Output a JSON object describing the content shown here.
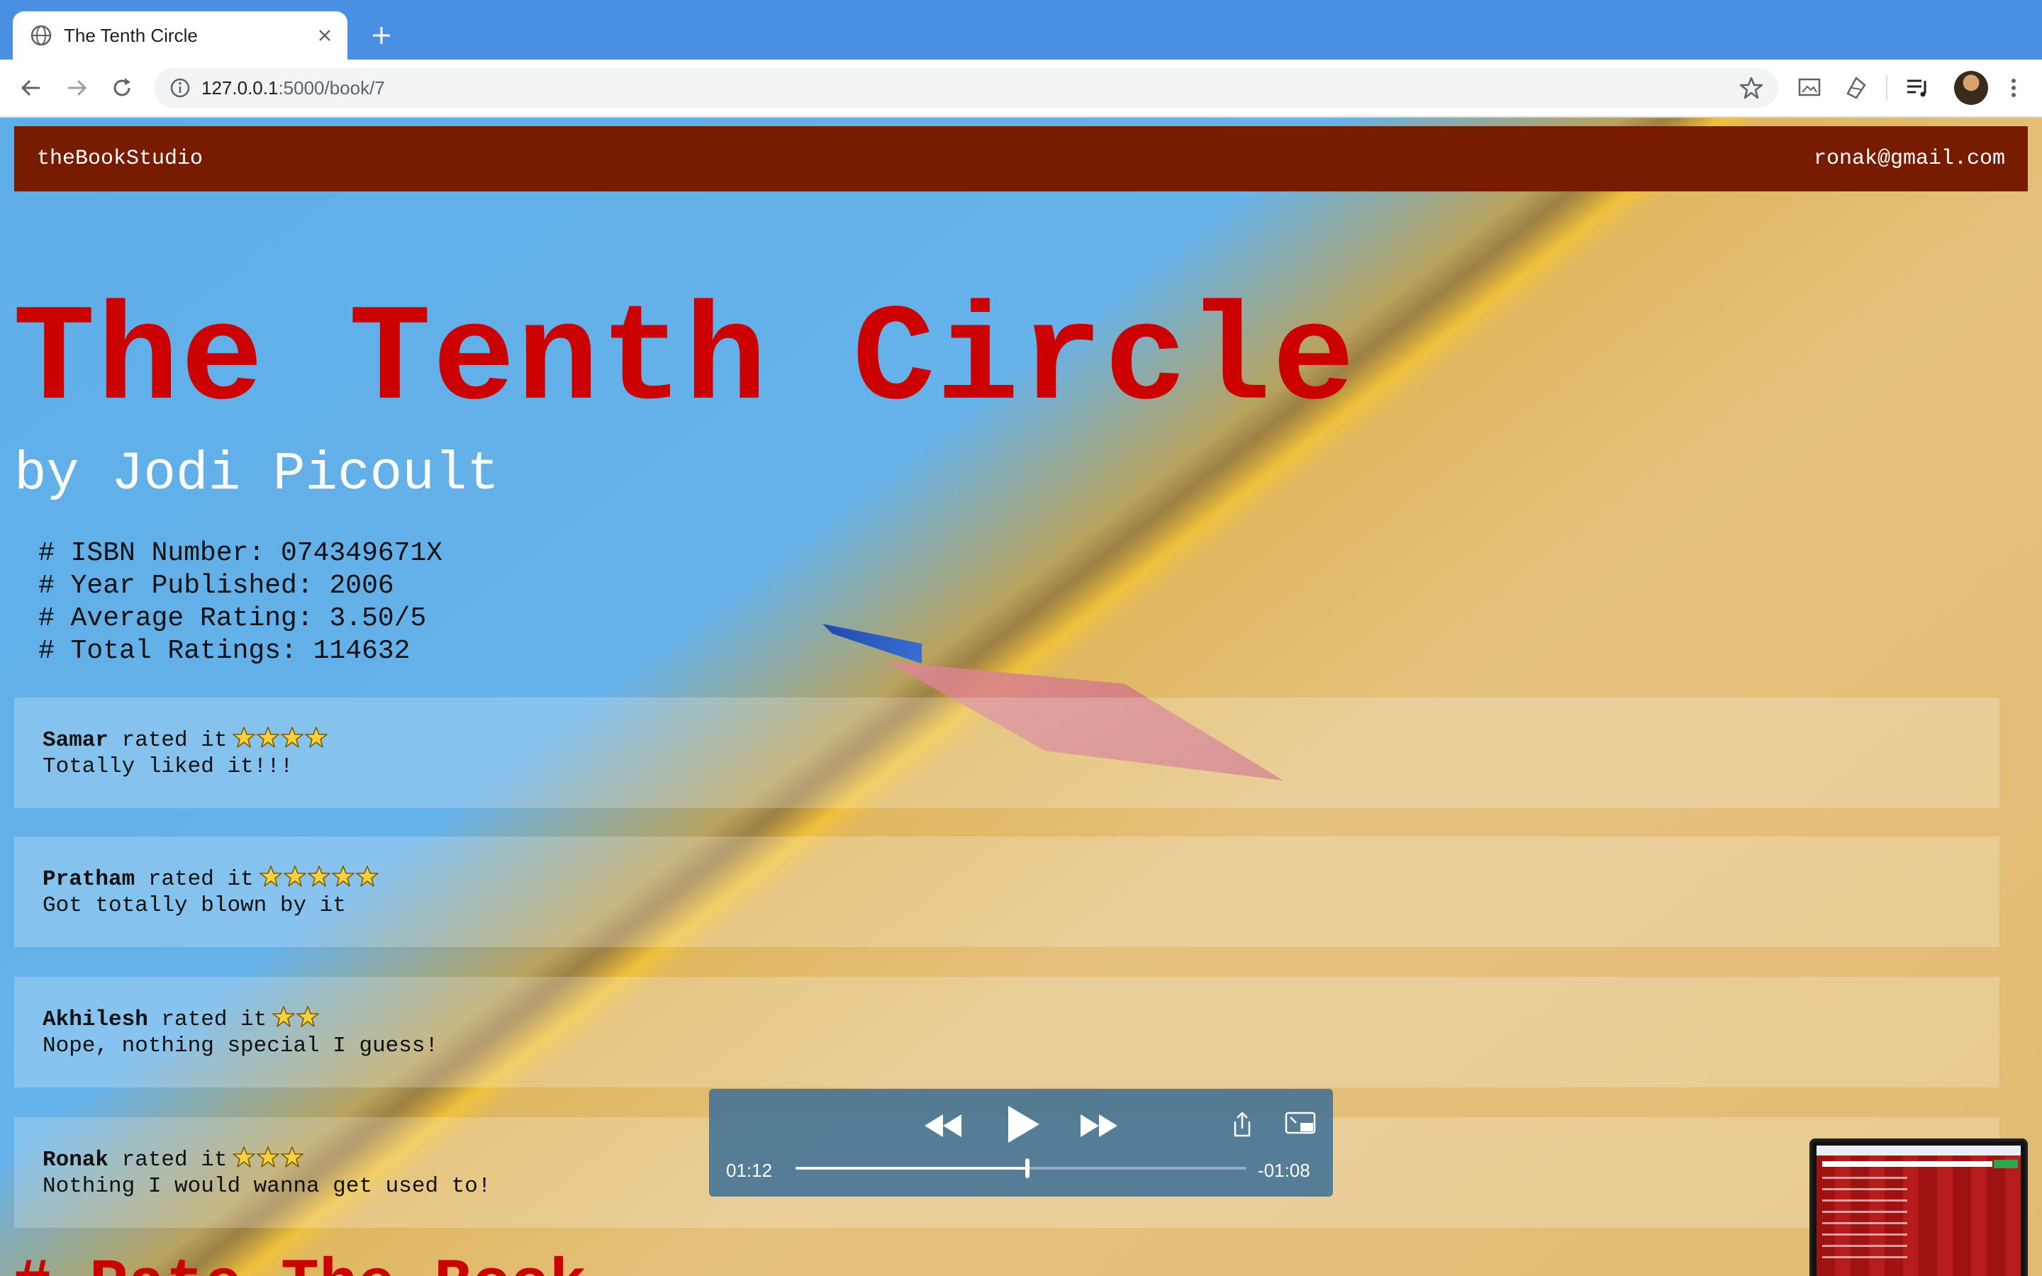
{
  "browser": {
    "tab_title": "The Tenth Circle",
    "url_host": "127.0.0.1",
    "url_path": ":5000/book/7"
  },
  "navbar": {
    "brand": "theBookStudio",
    "user_email": "ronak@gmail.com"
  },
  "book": {
    "title": "The Tenth Circle",
    "author_line": "by Jodi Picoult",
    "meta": [
      "# ISBN Number: 074349671X",
      "# Year Published: 2006",
      "# Average Rating: 3.50/5",
      "# Total Ratings: 114632"
    ]
  },
  "reviews": [
    {
      "user": "Samar",
      "rated_text": " rated it",
      "stars": 4,
      "comment": "Totally liked it!!!"
    },
    {
      "user": "Pratham",
      "rated_text": " rated it",
      "stars": 5,
      "comment": "Got totally blown by it"
    },
    {
      "user": "Akhilesh",
      "rated_text": " rated it",
      "stars": 2,
      "comment": "Nope, nothing special I guess!"
    },
    {
      "user": "Ronak",
      "rated_text": " rated it",
      "stars": 3,
      "comment": "Nothing I would wanna get used to!"
    }
  ],
  "rate_heading": "# Rate The Book",
  "media": {
    "elapsed": "01:12",
    "remaining": "-01:08",
    "progress": 0.514
  },
  "colors": {
    "navbar": "#771c00",
    "title": "#cc0000",
    "tabbar": "#4a90e2"
  }
}
